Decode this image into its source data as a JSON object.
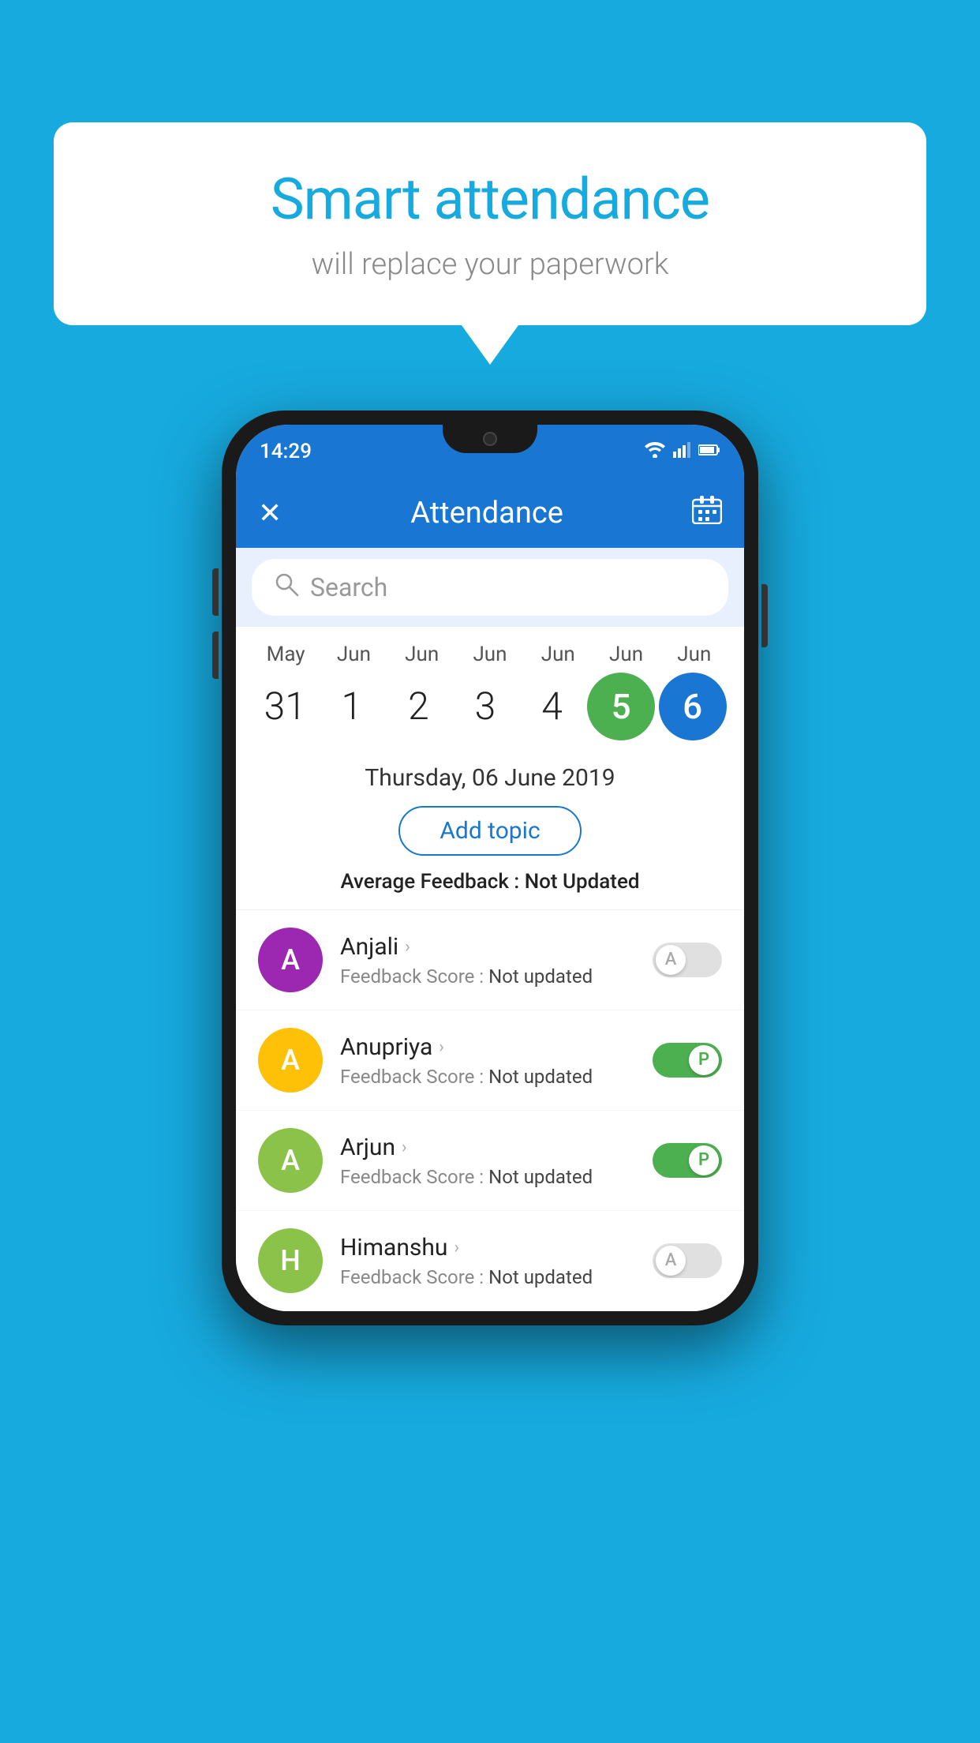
{
  "background_color": "#17AADF",
  "speech_bubble": {
    "title": "Smart attendance",
    "subtitle": "will replace your paperwork"
  },
  "status_bar": {
    "time": "14:29",
    "wifi": "▼",
    "signal": "▲",
    "battery": "▉"
  },
  "app_header": {
    "title": "Attendance",
    "close_icon": "✕",
    "calendar_icon": "📅"
  },
  "search": {
    "placeholder": "Search"
  },
  "calendar": {
    "months": [
      "May",
      "Jun",
      "Jun",
      "Jun",
      "Jun",
      "Jun",
      "Jun"
    ],
    "dates": [
      "31",
      "1",
      "2",
      "3",
      "4",
      "5",
      "6"
    ],
    "today_index": 5,
    "selected_index": 6
  },
  "date_info": {
    "selected_date": "Thursday, 06 June 2019",
    "add_topic_label": "Add topic",
    "avg_feedback_label": "Average Feedback :",
    "avg_feedback_value": "Not Updated"
  },
  "students": [
    {
      "name": "Anjali",
      "feedback_label": "Feedback Score :",
      "feedback_value": "Not updated",
      "avatar_letter": "A",
      "avatar_color": "#9C27B0",
      "attendance": "absent"
    },
    {
      "name": "Anupriya",
      "feedback_label": "Feedback Score :",
      "feedback_value": "Not updated",
      "avatar_letter": "A",
      "avatar_color": "#FFC107",
      "attendance": "present"
    },
    {
      "name": "Arjun",
      "feedback_label": "Feedback Score :",
      "feedback_value": "Not updated",
      "avatar_letter": "A",
      "avatar_color": "#8BC34A",
      "attendance": "present"
    },
    {
      "name": "Himanshu",
      "feedback_label": "Feedback Score :",
      "feedback_value": "Not updated",
      "avatar_letter": "H",
      "avatar_color": "#8BC34A",
      "attendance": "absent"
    }
  ]
}
